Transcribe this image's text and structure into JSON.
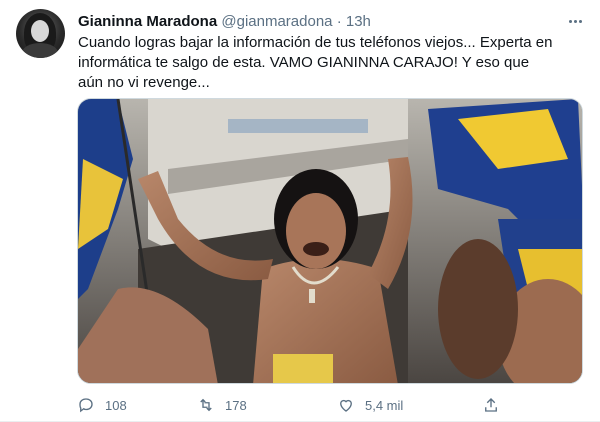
{
  "tweet": {
    "author_name": "Gianinna Maradona",
    "author_handle": "@gianmaradona",
    "separator": "·",
    "time": "13h",
    "text": "Cuando logras bajar la información de tus teléfonos viejos... Experta en informática te salgo de esta. VAMO GIANINNA CARAJO! Y eso que aún no vi revenge...",
    "media": {
      "icon": "photo"
    },
    "actions": {
      "reply_count": "108",
      "retweet_count": "178",
      "like_count": "5,4 mil"
    }
  },
  "colors": {
    "text_primary": "#0f1419",
    "text_secondary": "#5b7083",
    "border": "#cfd9de"
  }
}
